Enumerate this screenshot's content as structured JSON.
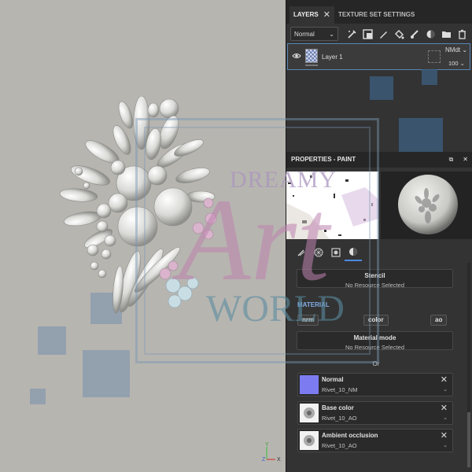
{
  "layers_panel": {
    "tabs": [
      {
        "label": "LAYERS",
        "close": "✕"
      },
      {
        "label": "TEXTURE SET SETTINGS"
      }
    ],
    "blend_mode": "Normal",
    "layer": {
      "name": "Layer 1",
      "blend_short": "NMdt",
      "opacity": "100"
    }
  },
  "properties": {
    "title": "PROPERTIES - PAINT",
    "stencil": {
      "title": "Stencil",
      "value": "No Resource Selected"
    },
    "material_label": "MATERIAL",
    "channels": [
      "nrm",
      "color",
      "ao"
    ],
    "material_mode": {
      "title": "Material mode",
      "value": "No Resource Selected"
    },
    "or_label": "Or",
    "resources": [
      {
        "title": "Normal",
        "value": "Rivet_10_NM",
        "thumb_color": "#7d7bf0"
      },
      {
        "title": "Base color",
        "value": "Rivet_10_AO",
        "thumb_color": "#e6e6e6"
      },
      {
        "title": "Ambient occlusion",
        "value": "Rivet_10_AO",
        "thumb_color": "#e6e6e6"
      }
    ]
  },
  "watermark": {
    "line1": "DREAMY",
    "letters": "Art",
    "line3": "WORLD"
  },
  "axis": {
    "y": "Y",
    "z": "Z",
    "x": "X"
  },
  "colors": {
    "accent": "#4c8be0",
    "panel": "#333333",
    "viewport": "#b7b5b0"
  }
}
